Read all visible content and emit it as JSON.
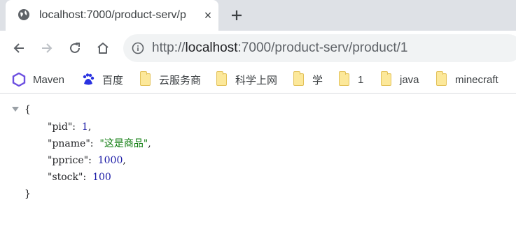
{
  "tab": {
    "title": "localhost:7000/product-serv/p",
    "close_icon": "×",
    "newtab_icon": "+"
  },
  "toolbar": {
    "url_host": "localhost",
    "url_rest": ":7000/product-serv/product/1",
    "url_scheme": "http://"
  },
  "bookmarks": [
    {
      "label": "Maven",
      "icon": "maven-hexagon-icon"
    },
    {
      "label": "百度",
      "icon": "baidu-paw-icon"
    },
    {
      "label": "云服务商",
      "icon": "folder-icon"
    },
    {
      "label": "科学上网",
      "icon": "folder-icon"
    },
    {
      "label": "学",
      "icon": "folder-icon"
    },
    {
      "label": "1",
      "icon": "folder-icon"
    },
    {
      "label": "java",
      "icon": "folder-icon"
    },
    {
      "label": "minecraft",
      "icon": "folder-icon"
    }
  ],
  "json_view": {
    "open_brace": "{",
    "close_brace": "}",
    "lines": [
      {
        "key": "\"pid\"",
        "sep": ":  ",
        "value": "1",
        "type": "num",
        "comma": ","
      },
      {
        "key": "\"pname\"",
        "sep": ":  ",
        "value": "\"这是商品\"",
        "type": "str",
        "comma": ","
      },
      {
        "key": "\"pprice\"",
        "sep": ":  ",
        "value": "1000",
        "type": "num",
        "comma": ","
      },
      {
        "key": "\"stock\"",
        "sep": ":  ",
        "value": "100",
        "type": "num",
        "comma": ""
      }
    ]
  },
  "colors": {
    "tabstrip": "#dee1e6",
    "omnibox": "#f1f3f4",
    "json_number": "#1a1aa6",
    "json_string": "#0b7a0b"
  }
}
